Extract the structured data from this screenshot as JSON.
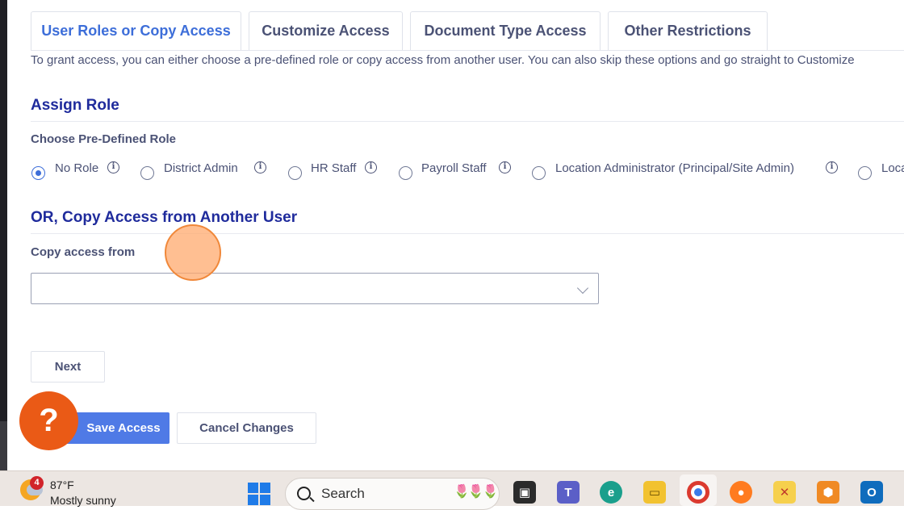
{
  "tabs": [
    {
      "label": "User Roles or Copy Access",
      "active": true
    },
    {
      "label": "Customize Access",
      "active": false
    },
    {
      "label": "Document Type Access",
      "active": false
    },
    {
      "label": "Other Restrictions",
      "active": false
    }
  ],
  "intro_text": "To grant access, you can either choose a pre-defined role or copy access from another user. You can also skip these options and go straight to Customize",
  "assign_role": {
    "title": "Assign Role",
    "label": "Choose Pre-Defined Role",
    "roles": [
      {
        "label": "No Role",
        "selected": true
      },
      {
        "label": "District Admin",
        "selected": false
      },
      {
        "label": "HR Staff",
        "selected": false
      },
      {
        "label": "Payroll Staff",
        "selected": false
      },
      {
        "label": "Location Administrator (Principal/Site Admin)",
        "selected": false
      },
      {
        "label": "Loca",
        "selected": false
      }
    ]
  },
  "copy_access": {
    "title": "OR, Copy Access from Another User",
    "label": "Copy access from",
    "value": ""
  },
  "buttons": {
    "next": "Next",
    "save": "Save Access",
    "cancel": "Cancel Changes",
    "help": "?"
  },
  "taskbar": {
    "weather_badge": "4",
    "temperature": "87°F",
    "condition": "Mostly sunny",
    "search_label": "Search",
    "apps": [
      "task-view-icon",
      "teams-icon",
      "edge-icon",
      "file-explorer-icon",
      "chrome-icon",
      "firefox-icon",
      "app-icon",
      "app-icon-2",
      "outlook-icon"
    ]
  },
  "colors": {
    "accent": "#3d6ed9",
    "section_title": "#1f2b9c",
    "primary_button": "#4f7ae6",
    "help_button": "#ea5a16"
  }
}
